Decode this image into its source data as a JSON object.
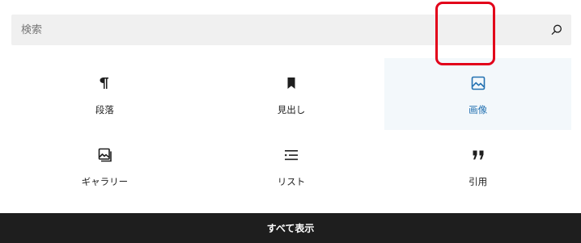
{
  "search": {
    "placeholder": "検索",
    "icon": "search-icon"
  },
  "blocks": [
    {
      "label": "段落",
      "icon": "paragraph-icon"
    },
    {
      "label": "見出し",
      "icon": "bookmark-icon"
    },
    {
      "label": "画像",
      "icon": "image-icon",
      "selected": true
    },
    {
      "label": "ギャラリー",
      "icon": "gallery-icon"
    },
    {
      "label": "リスト",
      "icon": "list-icon"
    },
    {
      "label": "引用",
      "icon": "quote-icon"
    }
  ],
  "footer": {
    "label": "すべて表示"
  },
  "colors": {
    "accent": "#2271b1",
    "highlight": "#e2001a",
    "footer_bg": "#1e1e1e"
  }
}
